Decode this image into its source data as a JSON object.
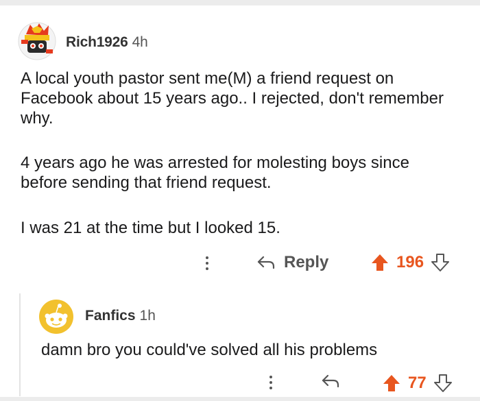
{
  "comment": {
    "author": "Rich1926",
    "age": "4h",
    "paragraphs": [
      "A local youth pastor sent me(M) a friend request on Facebook about 15 years ago.. I rejected, don't remember why.",
      "4 years ago he was arrested for molesting boys since before sending that friend request.",
      "I was 21 at the time but I looked 15."
    ],
    "reply_label": "Reply",
    "score": "196"
  },
  "reply": {
    "author": "Fanfics",
    "age": "1h",
    "text": "damn bro you could've solved all his problems",
    "score": "77"
  },
  "colors": {
    "upvote": "#e8561f",
    "muted": "#555555",
    "avatar_yellow": "#f2c12e"
  },
  "icons": {
    "more": "more-vertical-icon",
    "reply": "reply-arrow-icon",
    "upvote": "upvote-arrow-icon",
    "downvote": "downvote-arrow-icon"
  }
}
